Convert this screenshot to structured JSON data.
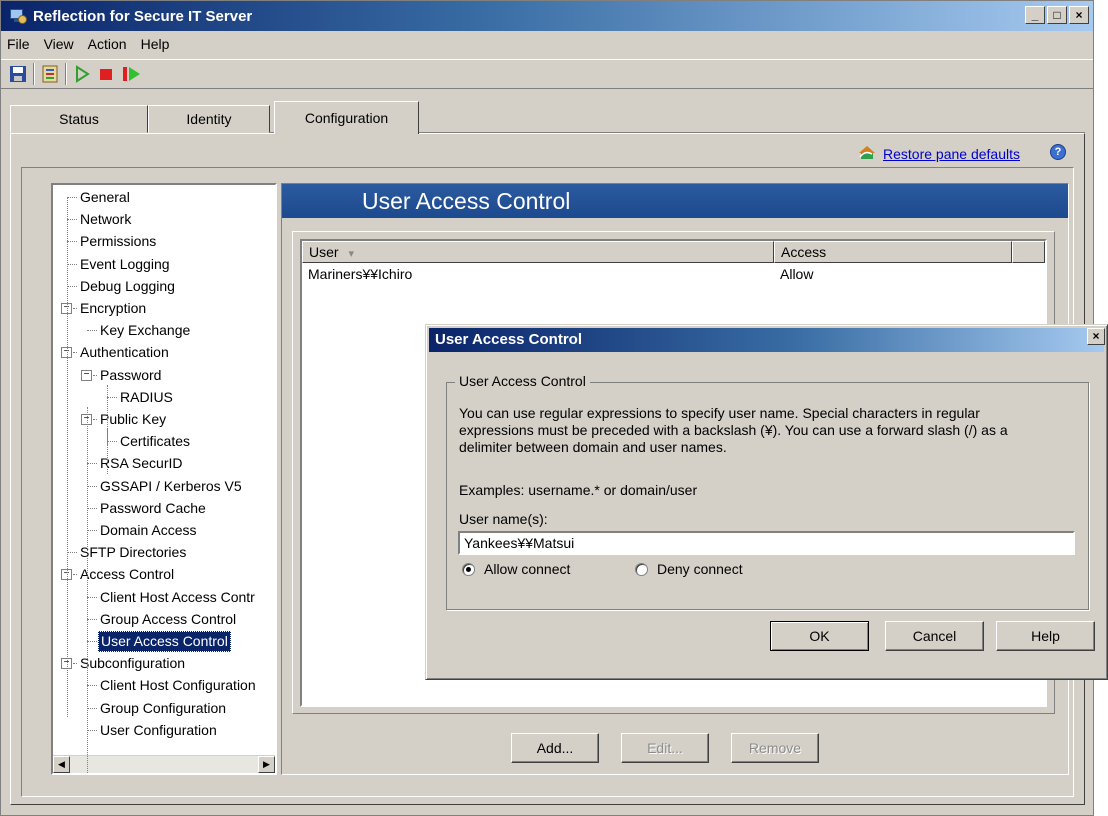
{
  "window": {
    "title": "Reflection for Secure IT Server"
  },
  "menu": [
    "File",
    "View",
    "Action",
    "Help"
  ],
  "toolbar": {
    "icons": [
      "save-icon",
      "settings-icon",
      "play-outline-icon",
      "stop-icon",
      "restart-icon"
    ]
  },
  "tabs": [
    {
      "label": "Status",
      "active": false
    },
    {
      "label": "Identity",
      "active": false
    },
    {
      "label": "Configuration",
      "active": true
    }
  ],
  "restore_link": "Restore pane defaults",
  "help_glyph": "?",
  "tree": {
    "items": [
      {
        "label": "General"
      },
      {
        "label": "Network"
      },
      {
        "label": "Permissions"
      },
      {
        "label": "Event Logging"
      },
      {
        "label": "Debug Logging"
      },
      {
        "label": "Encryption",
        "expander": "−"
      },
      {
        "label": "Key Exchange"
      },
      {
        "label": "Authentication",
        "expander": "−"
      },
      {
        "label": "Password",
        "expander": "−"
      },
      {
        "label": "RADIUS"
      },
      {
        "label": "Public Key",
        "expander": "−"
      },
      {
        "label": "Certificates"
      },
      {
        "label": "RSA SecurID"
      },
      {
        "label": "GSSAPI / Kerberos V5"
      },
      {
        "label": "Password Cache"
      },
      {
        "label": "Domain Access"
      },
      {
        "label": "SFTP Directories"
      },
      {
        "label": "Access Control",
        "expander": "−"
      },
      {
        "label": "Client Host Access Contr"
      },
      {
        "label": "Group Access Control"
      },
      {
        "label": "User Access Control",
        "selected": true
      },
      {
        "label": "Subconfiguration",
        "expander": "−"
      },
      {
        "label": "Client Host Configuration"
      },
      {
        "label": "Group Configuration"
      },
      {
        "label": "User Configuration"
      }
    ]
  },
  "content": {
    "header": "User Access Control",
    "columns": [
      "User",
      "Access"
    ],
    "sort_glyph": "▾",
    "rows": [
      {
        "user": "Mariners¥¥Ichiro",
        "access": "Allow"
      }
    ],
    "buttons": {
      "add": "Add...",
      "edit": "Edit...",
      "remove": "Remove"
    }
  },
  "dialog": {
    "title": "User Access Control",
    "close": "×",
    "group_label": "User Access Control",
    "description_lines": [
      "You can use regular expressions to specify user name.  Special characters in regular",
      "expressions must be preceded with a backslash (¥). You can use a forward slash (/) as a",
      "delimiter between domain and user names."
    ],
    "examples": "Examples: username.* or domain/user",
    "field_label": "User name(s):",
    "field_value": "Yankees¥¥Matsui",
    "radio_allow": "Allow connect",
    "radio_deny": "Deny connect",
    "selected": "allow",
    "buttons": {
      "ok": "OK",
      "cancel": "Cancel",
      "help": "Help"
    }
  }
}
